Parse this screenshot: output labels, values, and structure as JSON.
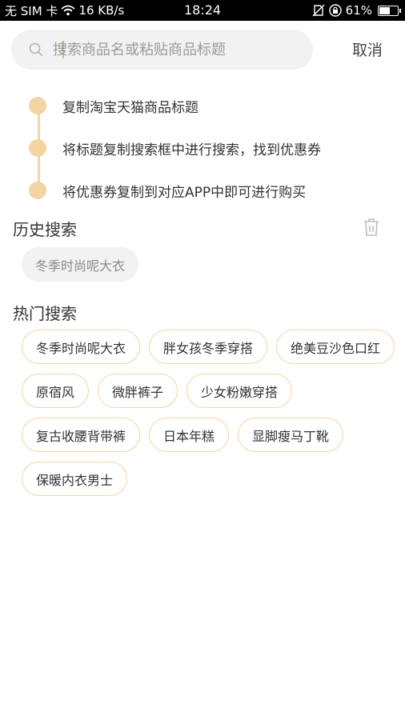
{
  "status_bar": {
    "carrier": "无 SIM 卡",
    "speed": "16 KB/s",
    "time": "18:24",
    "battery_text": "61%",
    "battery_level": 0.61
  },
  "search": {
    "placeholder": "搜索商品名或粘贴商品标题",
    "cancel_label": "取消"
  },
  "steps": [
    "复制淘宝天猫商品标题",
    "将标题复制搜索框中进行搜索，找到优惠券",
    "将优惠券复制到对应APP中即可进行购买"
  ],
  "history": {
    "title": "历史搜索",
    "items": [
      "冬季时尚呢大衣"
    ]
  },
  "hot": {
    "title": "热门搜索",
    "items": [
      "冬季时尚呢大衣",
      "胖女孩冬季穿搭",
      "绝美豆沙色口红",
      "原宿风",
      "微胖裤子",
      "少女粉嫩穿搭",
      "复古收腰背带裤",
      "日本年糕",
      "显脚瘦马丁靴",
      "保暖内衣男士"
    ]
  },
  "colors": {
    "accent": "#f4d4a3",
    "search_bg": "#f2f2f2",
    "text": "#333333"
  }
}
